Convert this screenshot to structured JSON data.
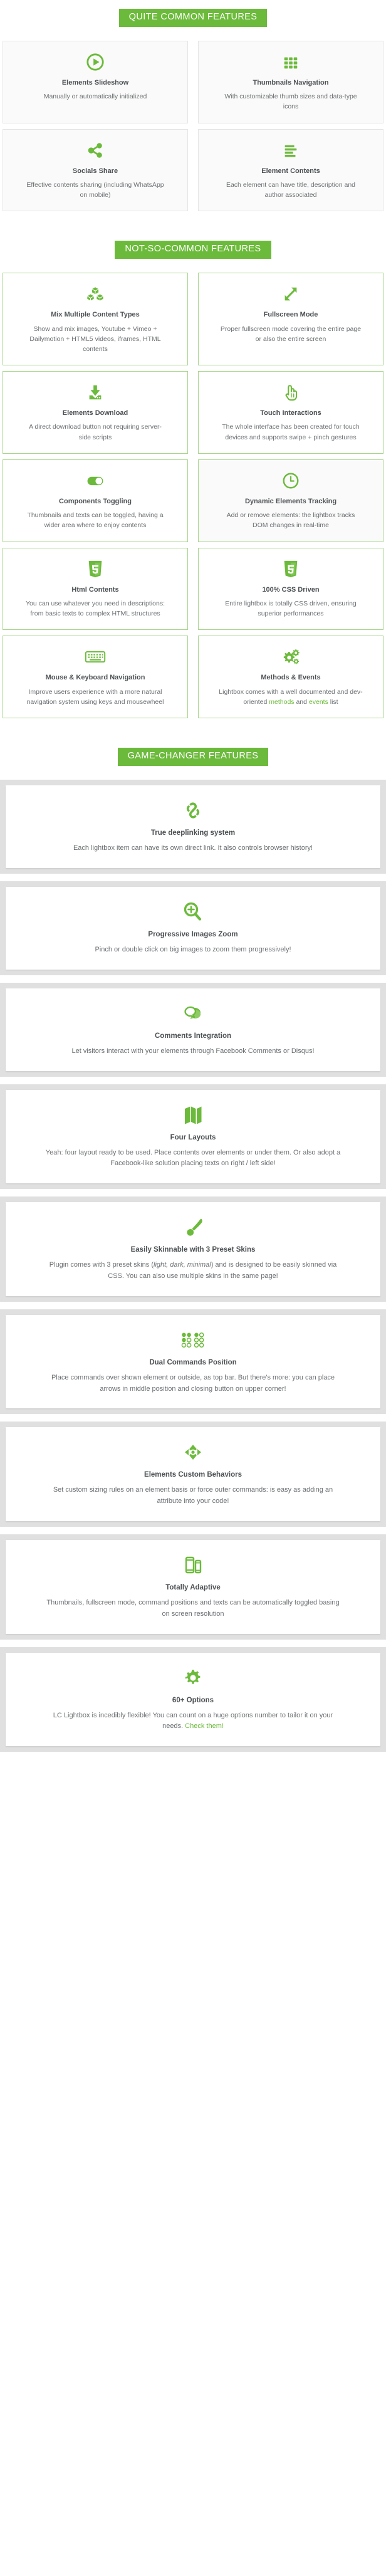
{
  "theme": {
    "accent": "#6cba3b",
    "card_border_grey": "#e4e6e6",
    "card_border_green": "#a6d58a",
    "panel_frame": "#e0e0e0",
    "title_color": "#4c5154",
    "text_color": "#6c7073"
  },
  "sections": [
    {
      "badge": "QUITE COMMON FEATURES",
      "cards": [
        {
          "icon": "play-circle-icon",
          "title": "Elements Slideshow",
          "desc": "Manually or automatically initialized"
        },
        {
          "icon": "grid-thumbnails-icon",
          "title": "Thumbnails Navigation",
          "desc": "With customizable thumb sizes and data-type icons"
        },
        {
          "icon": "share-nodes-icon",
          "title": "Socials Share",
          "desc": "Effective contents sharing (including WhatsApp on mobile)"
        },
        {
          "icon": "text-lines-icon",
          "title": "Element Contents",
          "desc": "Each element can have title, description and author associated"
        }
      ]
    },
    {
      "badge": "NOT-SO-COMMON FEATURES",
      "cards": [
        {
          "icon": "cubes-icon",
          "title": "Mix Multiple Content Types",
          "desc": "Show and mix images, Youtube + Vimeo + Dailymotion + HTML5 videos, iframes, HTML contents"
        },
        {
          "icon": "expand-arrows-icon",
          "title": "Fullscreen Mode",
          "desc": "Proper fullscreen mode covering the entire page or also the entire screen"
        },
        {
          "icon": "download-tray-icon",
          "title": "Elements Download",
          "desc": "A direct download button not requiring server-side scripts"
        },
        {
          "icon": "touch-hand-icon",
          "title": "Touch Interactions",
          "desc": "The whole interface has been created for touch devices and supports swipe + pinch gestures"
        },
        {
          "icon": "toggle-switch-icon",
          "title": "Components Toggling",
          "desc": "Thumbnails and texts can be toggled, having a wider area where to enjoy contents"
        },
        {
          "icon": "clock-icon",
          "title": "Dynamic Elements Tracking",
          "desc": "Add or remove elements: the lightbox tracks DOM changes in real-time"
        },
        {
          "icon": "html5-shield-icon",
          "title": "Html Contents",
          "desc": "You can use whatever you need in descriptions: from basic texts to complex HTML structures"
        },
        {
          "icon": "css3-shield-icon",
          "title": "100% CSS Driven",
          "desc": "Entire lightbox is totally CSS driven, ensuring superior performances"
        },
        {
          "icon": "keyboard-icon",
          "title": "Mouse & Keyboard Navigation",
          "desc": "Improve users experience with a more natural navigation system using keys and mousewheel"
        },
        {
          "icon": "gears-icon",
          "title": "Methods & Events",
          "desc_prefix": "Lightbox comes with a well documented and dev-oriented ",
          "desc_link1": "methods",
          "desc_mid": " and ",
          "desc_link2": "events",
          "desc_suffix": " list"
        }
      ]
    }
  ],
  "game_changer": {
    "badge": "GAME-CHANGER FEATURES",
    "panels": [
      {
        "icon": "chain-link-icon",
        "title": "True deeplinking system",
        "desc": "Each lightbox item can have its own direct link. It also controls browser history!"
      },
      {
        "icon": "zoom-in-icon",
        "title": "Progressive Images Zoom",
        "desc": "Pinch or double click on big images to zoom them progressively!"
      },
      {
        "icon": "comment-bubbles-icon",
        "title": "Comments Integration",
        "desc": "Let visitors interact with your elements through Facebook Comments or Disqus!"
      },
      {
        "icon": "map-fold-icon",
        "title": "Four Layouts",
        "desc": "Yeah: four layout ready to be used. Place contents over elements or under them. Or also adopt a Facebook-like solution placing texts on right / left side!"
      },
      {
        "icon": "paint-brush-icon",
        "title": "Easily Skinnable with 3 Preset Skins",
        "desc_prefix": "Plugin comes with 3 preset skins (",
        "desc_em": "light, dark, minimal",
        "desc_suffix": ") and is designed to be easily skinned via CSS. You can also use multiple skins in the same page!"
      },
      {
        "icon": "dots-positions-icon",
        "title": "Dual Commands Position",
        "desc": "Place commands over shown element or outside, as top bar. But there's more: you can place arrows in middle position and closing button on upper corner!"
      },
      {
        "icon": "custom-behaviors-icon",
        "title": "Elements Custom Behaviors",
        "desc": "Set custom sizing rules on an element basis or force outer commands: is easy as adding an attribute into your code!"
      },
      {
        "icon": "devices-icon",
        "title": "Totally Adaptive",
        "desc": "Thumbnails, fullscreen mode, command positions and texts can be automatically toggled basing on screen resolution"
      },
      {
        "icon": "options-gear-icon",
        "title": "60+ Options",
        "desc_prefix": "LC Lightbox is incedibly flexible! You can count on a huge options number to tailor it on your needs. ",
        "desc_link": "Check them!"
      }
    ]
  }
}
